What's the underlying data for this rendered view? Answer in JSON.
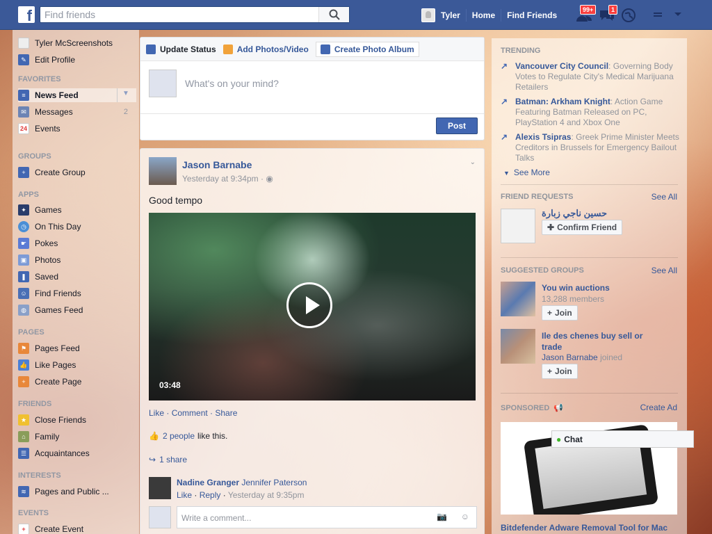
{
  "topbar": {
    "logo": "f",
    "search_placeholder": "Find friends",
    "user_name": "Tyler",
    "home": "Home",
    "find_friends": "Find Friends",
    "friend_requests_badge": "99+",
    "messages_badge": "1"
  },
  "left": {
    "profile_name": "Tyler McScreenshots",
    "edit_profile": "Edit Profile",
    "favorites_head": "FAVORITES",
    "news_feed": "News Feed",
    "messages": "Messages",
    "messages_count": "2",
    "events": "Events",
    "events_icon": "24",
    "groups_head": "GROUPS",
    "create_group": "Create Group",
    "apps_head": "APPS",
    "games": "Games",
    "on_this_day": "On This Day",
    "pokes": "Pokes",
    "photos": "Photos",
    "saved": "Saved",
    "find_friends": "Find Friends",
    "games_feed": "Games Feed",
    "pages_head": "PAGES",
    "pages_feed": "Pages Feed",
    "like_pages": "Like Pages",
    "create_page": "Create Page",
    "friends_head": "FRIENDS",
    "close_friends": "Close Friends",
    "family": "Family",
    "acquaintances": "Acquaintances",
    "interests_head": "INTERESTS",
    "pages_public": "Pages and Public ...",
    "events_head": "EVENTS",
    "create_event": "Create Event"
  },
  "composer": {
    "tab_status": "Update Status",
    "tab_photos": "Add Photos/Video",
    "tab_album": "Create Photo Album",
    "placeholder": "What's on your mind?",
    "post": "Post"
  },
  "story": {
    "author": "Jason Barnabe",
    "time": "Yesterday at 9:34pm ·",
    "text": "Good tempo",
    "duration": "03:48",
    "like": "Like",
    "comment": "Comment",
    "share": "Share",
    "likes_link": "2 people",
    "likes_rest": "like this.",
    "shares": "1 share",
    "commenter1": "Nadine Granger",
    "commenter2": "Jennifer Paterson",
    "comment_like": "Like",
    "comment_reply": "Reply",
    "comment_time": "Yesterday at 9:35pm",
    "write_comment": "Write a comment..."
  },
  "right": {
    "trending_head": "TRENDING",
    "trends": [
      {
        "title": "Vancouver City Council",
        "text": ": Governing Body Votes to Regulate City's Medical Marijuana Retailers"
      },
      {
        "title": "Batman: Arkham Knight",
        "text": ": Action Game Featuring Batman Released on PC, PlayStation 4 and Xbox One"
      },
      {
        "title": "Alexis Tsipras",
        "text": ": Greek Prime Minister Meets Creditors in Brussels for Emergency Bailout Talks"
      }
    ],
    "see_more": "See More",
    "requests_head": "FRIEND REQUESTS",
    "see_all": "See All",
    "request_name": "حسين ناجي زبارة",
    "confirm": "Confirm Friend",
    "groups_head": "SUGGESTED GROUPS",
    "group1_name": "You win auctions",
    "group1_members": "13,288 members",
    "join": "Join",
    "group2_name": "Ile des chenes buy sell or trade",
    "group2_friend": "Jason Barnabe",
    "group2_joined": "joined",
    "sponsored_head": "SPONSORED",
    "create_ad": "Create Ad",
    "ad_title": "Bitdefender Adware Removal Tool for Mac",
    "chat": "Chat"
  }
}
